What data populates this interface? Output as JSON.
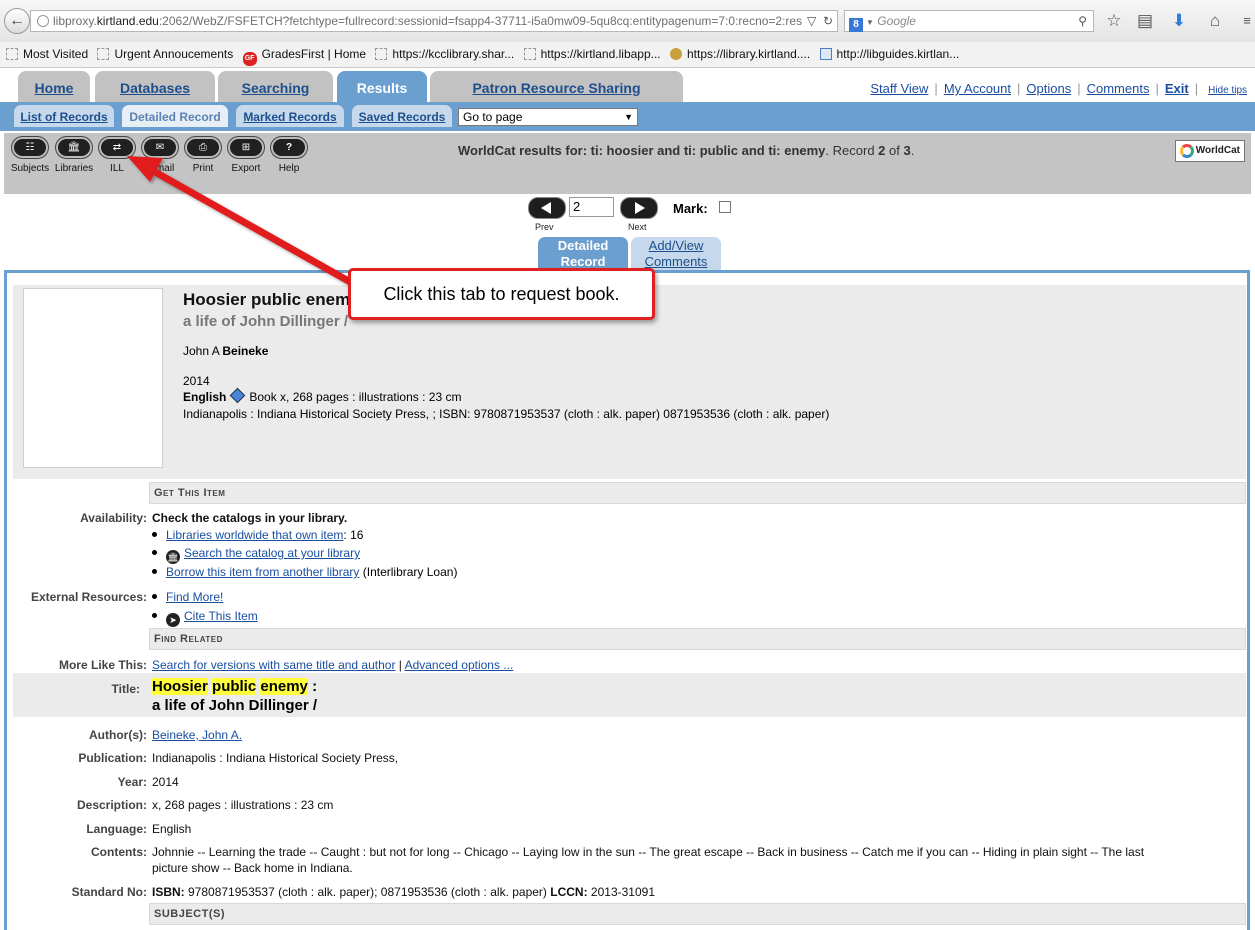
{
  "browser": {
    "url_prefix": "libproxy.",
    "url_host": "kirtland.edu",
    "url_rest": ":2062/WebZ/FSFETCH?fetchtype=fullrecord:sessionid=fsapp4-37711-i5a0mw09-5qu8cq:entitypagenum=7:0:recno=2:res",
    "search_engine": "Google"
  },
  "bookmarks": [
    {
      "label": "Most Visited"
    },
    {
      "label": "Urgent Annoucements"
    },
    {
      "label": "GradesFirst | Home"
    },
    {
      "label": "https://kcclibrary.shar..."
    },
    {
      "label": "https://kirtland.libapp..."
    },
    {
      "label": "https://library.kirtland...."
    },
    {
      "label": "http://libguides.kirtlan..."
    }
  ],
  "main_tabs": [
    "Home",
    "Databases",
    "Searching",
    "Results",
    "Patron Resource Sharing"
  ],
  "top_links": {
    "staff_view": "Staff View",
    "my_account": "My Account",
    "options": "Options",
    "comments": "Comments",
    "exit": "Exit",
    "hide_tips": "Hide tips"
  },
  "sub_tabs": [
    "List of Records",
    "Detailed Record",
    "Marked Records",
    "Saved Records"
  ],
  "goto_select": "Go to page",
  "tools": [
    {
      "label": "Subjects",
      "icon": "subjects-icon"
    },
    {
      "label": "Libraries",
      "icon": "library-icon"
    },
    {
      "label": "ILL",
      "icon": "ill-icon"
    },
    {
      "label": "E-mail",
      "icon": "email-icon"
    },
    {
      "label": "Print",
      "icon": "printer-icon"
    },
    {
      "label": "Export",
      "icon": "export-icon"
    },
    {
      "label": "Help",
      "icon": "help-icon"
    }
  ],
  "results": {
    "prefix": "WorldCat results for: ",
    "query": "ti: hoosier and ti: public and ti: enemy",
    "record_label": ". Record ",
    "record_num": "2",
    "of_label": " of ",
    "total": "3",
    "suffix": "."
  },
  "worldcat_logo": "WorldCat",
  "nav": {
    "prev": "Prev",
    "next": "Next",
    "record_value": "2",
    "mark": "Mark:"
  },
  "record_tabs": {
    "detailed": [
      "Detailed",
      "Record"
    ],
    "comments": [
      "Add/View",
      "Comments"
    ]
  },
  "summary": {
    "title": "Hoosier public enemy :",
    "subtitle": "a life of John Dillinger /",
    "author_first": "John A ",
    "author_last": "Beineke",
    "year": "2014",
    "language": "English",
    "format": "Book x, 268 pages : illustrations : 23 cm",
    "publication": "Indianapolis : Indiana Historical Society Press, ; ISBN: 9780871953537 (cloth : alk. paper) 0871953536 (cloth : alk. paper)"
  },
  "get_item": {
    "header": "Get This Item",
    "availability_label": "Availability:",
    "availability_text": "Check the catalogs in your library.",
    "link_worldwide": "Libraries worldwide that own item",
    "worldwide_count": ": 16",
    "link_catalog": "Search the catalog at your library",
    "link_borrow": "Borrow this item from another library",
    "borrow_note": " (Interlibrary Loan)",
    "external_label": "External Resources:",
    "link_find_more": "Find More!",
    "link_cite": "Cite This Item"
  },
  "find_related": {
    "header": "Find Related",
    "more_like_label": "More Like This:",
    "link_versions": "Search for versions with same title and author",
    "separator": " | ",
    "link_advanced": "Advanced options ..."
  },
  "details": {
    "title_label": "Title:",
    "title_words": [
      "Hoosier",
      "public",
      "enemy"
    ],
    "title_colon": " :",
    "subtitle": "a life of John Dillinger /",
    "author_label": "Author(s):",
    "author_value": "Beineke, John A.",
    "publication_label": "Publication:",
    "publication_value": "Indianapolis : Indiana Historical Society Press,",
    "year_label": "Year:",
    "year_value": "2014",
    "description_label": "Description:",
    "description_value": "x, 268 pages : illustrations : 23 cm",
    "language_label": "Language:",
    "language_value": "English",
    "contents_label": "Contents:",
    "contents_line1": "Johnnie -- Learning the trade -- Caught : but not for long -- Chicago -- Laying low in the sun -- The great escape -- Back in business -- Catch me if you can -- Hiding in plain sight -- The last",
    "contents_line2": "picture show -- Back home in Indiana.",
    "standard_label": "Standard No:",
    "isbn_label": "ISBN:",
    "isbn_value": " 9780871953537 (cloth : alk. paper); 0871953536 (cloth : alk. paper) ",
    "lccn_label": "LCCN:",
    "lccn_value": " 2013-31091",
    "subjects_header": "SUBJECT(S)"
  },
  "annotation": {
    "text": "Click this tab to request book.",
    "color": "#e01f1f"
  }
}
